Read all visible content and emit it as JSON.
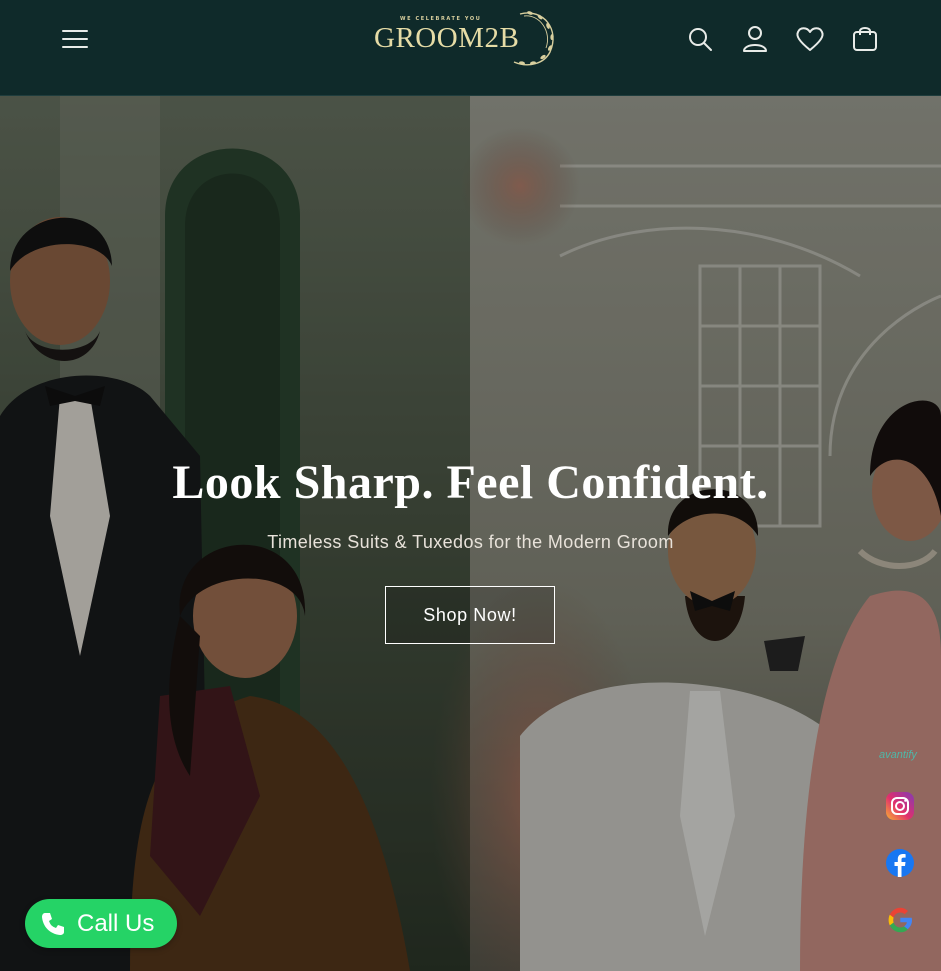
{
  "header": {
    "logo": {
      "tagline": "WE CELEBRATE YOU",
      "text": "GROOM2B"
    },
    "icons": [
      "menu-icon",
      "search-icon",
      "account-icon",
      "wishlist-heart-icon",
      "cart-bag-icon"
    ]
  },
  "hero": {
    "title": "Look Sharp. Feel Confident.",
    "subtitle": "Timeless Suits & Tuxedos for the Modern Groom",
    "cta_label": "Shop Now!"
  },
  "call_widget": {
    "label": "Call Us",
    "color": "#25d366"
  },
  "social_widget": {
    "brand": "avantify",
    "icons": [
      "instagram-icon",
      "facebook-icon",
      "google-icon"
    ]
  },
  "colors": {
    "header_bg": "#0f2a2a",
    "logo_gold": "#e6dca6"
  }
}
